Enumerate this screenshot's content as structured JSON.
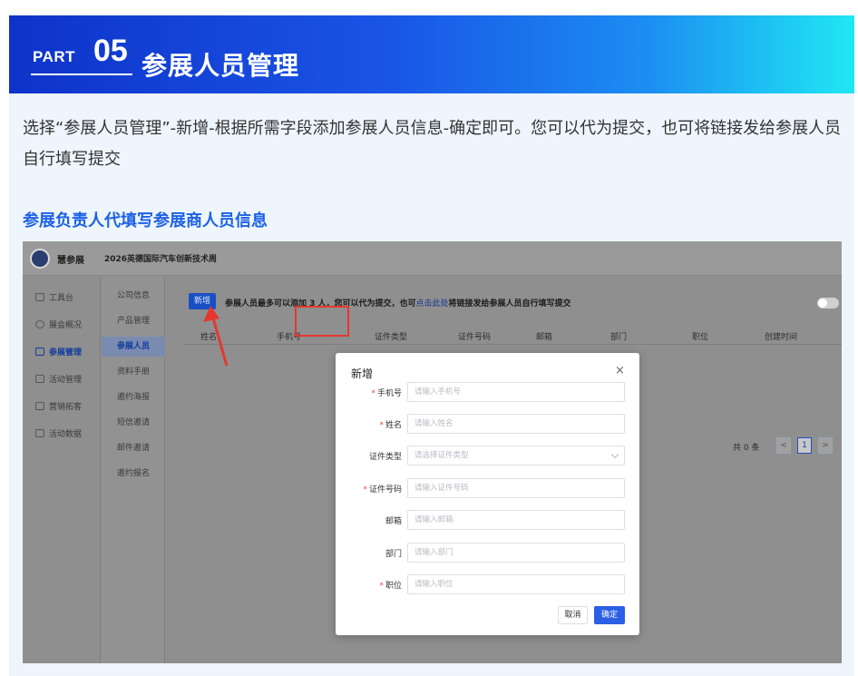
{
  "banner": {
    "part": "PART",
    "number": "05",
    "title": "参展人员管理"
  },
  "intro": "选择“参展人员管理”-新增-根据所需字段添加参展人员信息-确定即可。您可以代为提交，也可将链接发给参展人员自行填写提交",
  "subtitle": "参展负责人代填写参展商人员信息",
  "app": {
    "logo_text": "慧参展",
    "event_name": "2026英德国际汽车创新技术周",
    "sidebar": [
      "工具台",
      "展会概况",
      "参展管理",
      "活动管理",
      "营销拓客",
      "活动数据"
    ],
    "submenu": [
      "公司信息",
      "产品管理",
      "参展人员",
      "资料手册",
      "邀约海报",
      "短信邀请",
      "邮件邀请",
      "邀约报名"
    ],
    "add_button": "新增",
    "notice_prefix": "参展人员最多可以添加 3 人，您可以代为提交，也可",
    "notice_link": "点击此处",
    "notice_suffix": "将链接发给参展人员自行填写提交",
    "columns": [
      "姓名",
      "手机号",
      "证件类型",
      "证件号码",
      "邮箱",
      "部门",
      "职位",
      "创建时间"
    ],
    "pager": {
      "total": "共 0 条",
      "prev": "<",
      "page": "1",
      "next": ">"
    }
  },
  "modal": {
    "title": "新增",
    "close": "×",
    "fields": [
      {
        "label": "手机号",
        "required": true,
        "placeholder": "请输入手机号"
      },
      {
        "label": "姓名",
        "required": true,
        "placeholder": "请输入姓名"
      },
      {
        "label": "证件类型",
        "required": false,
        "placeholder": "请选择证件类型"
      },
      {
        "label": "证件号码",
        "required": true,
        "placeholder": "请输入证件号码"
      },
      {
        "label": "邮箱",
        "required": false,
        "placeholder": "请输入邮箱"
      },
      {
        "label": "部门",
        "required": false,
        "placeholder": "请输入部门"
      },
      {
        "label": "职位",
        "required": true,
        "placeholder": "请输入职位"
      }
    ],
    "cancel": "取消",
    "confirm": "确定"
  },
  "colors": {
    "brand_blue": "#1d62e6",
    "highlight_red": "#e6372e",
    "primary_button": "#2b5fe4"
  }
}
